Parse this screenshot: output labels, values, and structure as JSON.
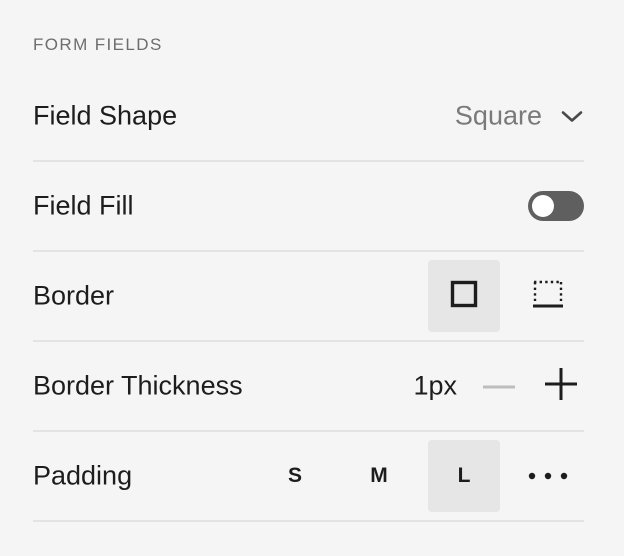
{
  "section": {
    "title": "FORM FIELDS"
  },
  "field_shape": {
    "label": "Field Shape",
    "value": "Square",
    "icon": "chevron-down-icon"
  },
  "field_fill": {
    "label": "Field Fill",
    "enabled": false
  },
  "border": {
    "label": "Border",
    "options": [
      {
        "icon": "border-all-icon",
        "selected": true
      },
      {
        "icon": "border-bottom-icon",
        "selected": false
      }
    ]
  },
  "border_thickness": {
    "label": "Border Thickness",
    "value": "1px",
    "decrease_icon": "minus-icon",
    "increase_icon": "plus-icon",
    "decrease_enabled": false
  },
  "padding": {
    "label": "Padding",
    "options": [
      "S",
      "M",
      "L"
    ],
    "selected": "L",
    "more_icon": "more-horizontal-icon"
  },
  "colors": {
    "background": "#f5f5f5",
    "text": "#1d1d1d",
    "muted": "#6d6d6d",
    "toggle_off": "#5f5f5f",
    "selected_bg": "#e6e6e6",
    "divider": "#e3e3e3"
  }
}
